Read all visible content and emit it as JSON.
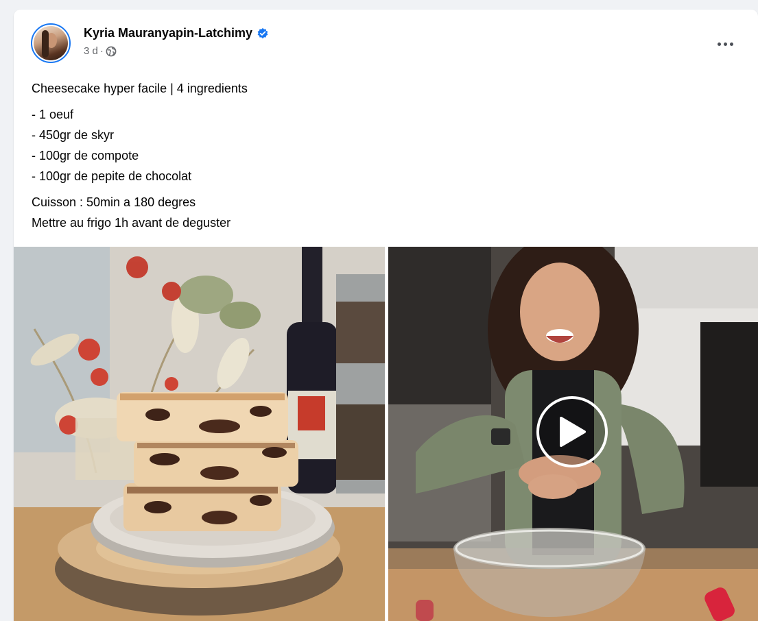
{
  "post": {
    "author": "Kyria Mauranyapin-Latchimy",
    "time": "3 d",
    "separator": "·",
    "title_line": "Cheesecake hyper facile | 4 ingredients",
    "ingredients": [
      "- 1 oeuf",
      "- 450gr de skyr",
      "- 100gr de compote",
      "- 100gr de pepite de chocolat"
    ],
    "instructions": [
      "Cuisson : 50min a 180 degres",
      "Mettre au frigo 1h avant de deguster"
    ]
  },
  "icons": {
    "verified": "verified-badge-icon",
    "privacy": "globe-icon",
    "more": "more-options-icon",
    "play": "play-icon"
  },
  "colors": {
    "accent": "#1877f2",
    "secondary_text": "#65676b",
    "primary_text": "#050505",
    "background": "#f0f2f5"
  }
}
